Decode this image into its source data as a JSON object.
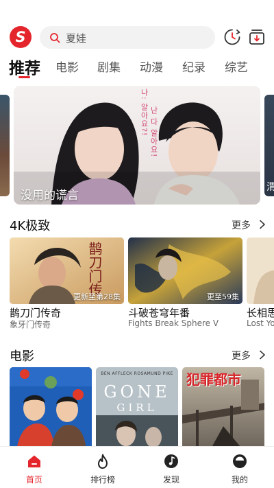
{
  "header": {
    "logo_letter": "S",
    "search_placeholder": "夏娃"
  },
  "tabs": [
    "推荐",
    "电影",
    "剧集",
    "动漫",
    "纪录",
    "综艺"
  ],
  "banner": {
    "title": "没用的谎言",
    "poster_text_1": "나: 알아요?!",
    "poster_text_2": "난 다 알아요!",
    "right_peek_label": "渭"
  },
  "sections": {
    "fourk": {
      "title": "4K极致",
      "more": "更多",
      "items": [
        {
          "badge": "更新至第28集",
          "title": "鹊刀门传奇",
          "subtitle": "象牙门传奇",
          "art_text": "鹊刀门传"
        },
        {
          "badge": "更至59集",
          "title": "斗破苍穹年番",
          "subtitle": "Fights Break Sphere V"
        },
        {
          "title": "长相思",
          "subtitle": "Lost You"
        }
      ]
    },
    "movies": {
      "title": "电影",
      "more": "更多",
      "items": [
        {
          "art_text": ""
        },
        {
          "art_text_top": "BEN AFFLECK   ROSAMUND PIKE",
          "art_text_main": "GONE",
          "art_text_sub": "GIRL"
        },
        {
          "art_text": "犯罪都市"
        }
      ]
    }
  },
  "bottom_nav": [
    {
      "label": "首页",
      "icon": "home-icon"
    },
    {
      "label": "排行榜",
      "icon": "fire-icon"
    },
    {
      "label": "发现",
      "icon": "music-note-icon"
    },
    {
      "label": "我的",
      "icon": "profile-icon"
    }
  ],
  "colors": {
    "accent": "#e5252c"
  }
}
